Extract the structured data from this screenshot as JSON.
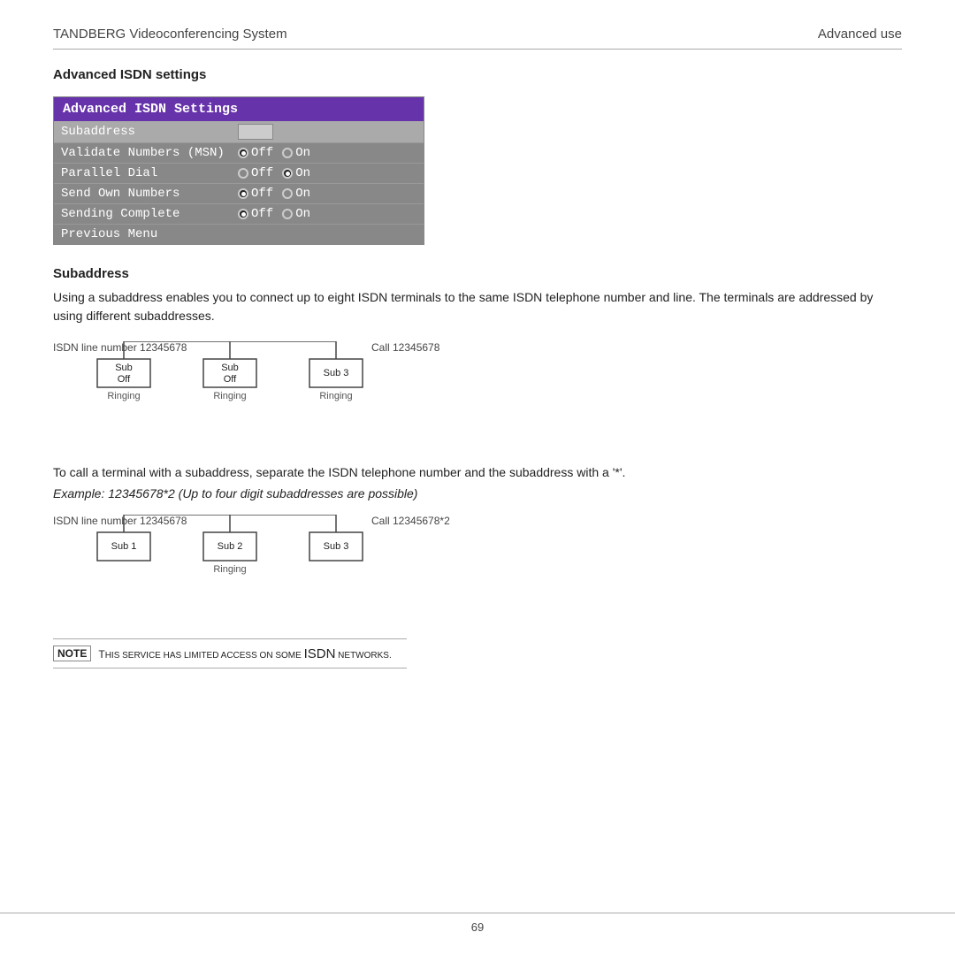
{
  "header": {
    "left": "TANDBERG Videoconferencing System",
    "right": "Advanced use"
  },
  "section_heading": "Advanced ISDN settings",
  "settings_box": {
    "title": "Advanced ISDN Settings",
    "rows": [
      {
        "label": "Subaddress",
        "type": "input"
      },
      {
        "label": "Validate Numbers (MSN)",
        "type": "radio",
        "off_selected": true,
        "on_selected": false
      },
      {
        "label": "Parallel Dial",
        "type": "radio",
        "off_selected": false,
        "on_selected": true
      },
      {
        "label": "Send Own Numbers",
        "type": "radio",
        "off_selected": true,
        "on_selected": false
      },
      {
        "label": "Sending Complete",
        "type": "radio",
        "off_selected": true,
        "on_selected": false
      },
      {
        "label": "Previous Menu",
        "type": "none"
      }
    ]
  },
  "subaddress": {
    "title": "Subaddress",
    "description": "Using a subaddress enables you to connect up to eight ISDN terminals to the same ISDN telephone number and line. The terminals are addressed by using different subaddresses.",
    "diagram1": {
      "line_label": "ISDN line number 12345678",
      "call_label": "Call 12345678",
      "boxes": [
        {
          "label": "Sub\nOff",
          "sublabel": "Ringing"
        },
        {
          "label": "Sub\nOff",
          "sublabel": "Ringing"
        },
        {
          "label": "Sub 3",
          "sublabel": "Ringing"
        }
      ]
    },
    "call_text": "To call a terminal with a subaddress, separate the ISDN telephone number and the subaddress with a '*'.",
    "example_text": "Example:  12345678*2 (Up to four digit subaddresses are possible)",
    "diagram2": {
      "line_label": "ISDN line number 12345678",
      "call_label": "Call 12345678*2",
      "boxes": [
        {
          "label": "Sub 1",
          "sublabel": ""
        },
        {
          "label": "Sub 2",
          "sublabel": "Ringing"
        },
        {
          "label": "Sub 3",
          "sublabel": ""
        }
      ]
    }
  },
  "note": {
    "label": "NOTE",
    "text": "This service has limited access on some ISDN networks."
  },
  "footer": {
    "page_number": "69"
  }
}
